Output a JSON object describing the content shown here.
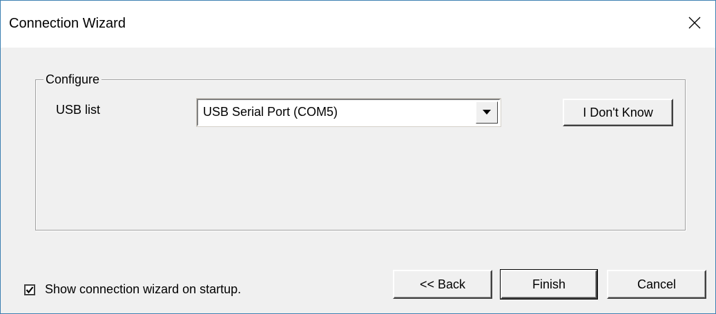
{
  "window": {
    "title": "Connection Wizard"
  },
  "configure_group": {
    "legend": "Configure",
    "usb_label": "USB list",
    "usb_selected": "USB Serial Port (COM5)",
    "dont_know_label": "I Don't Know"
  },
  "footer": {
    "show_on_startup_label": "Show connection wizard on startup.",
    "show_on_startup_checked": true,
    "back_label": "<< Back",
    "finish_label": "Finish",
    "cancel_label": "Cancel"
  },
  "icons": {
    "close": "close-icon",
    "dropdown": "dropdown-arrow-icon",
    "check": "checkmark-icon"
  },
  "colors": {
    "window_border": "#3c7fb1",
    "dialog_background": "#f0f0f0",
    "titlebar_background": "#ffffff"
  }
}
